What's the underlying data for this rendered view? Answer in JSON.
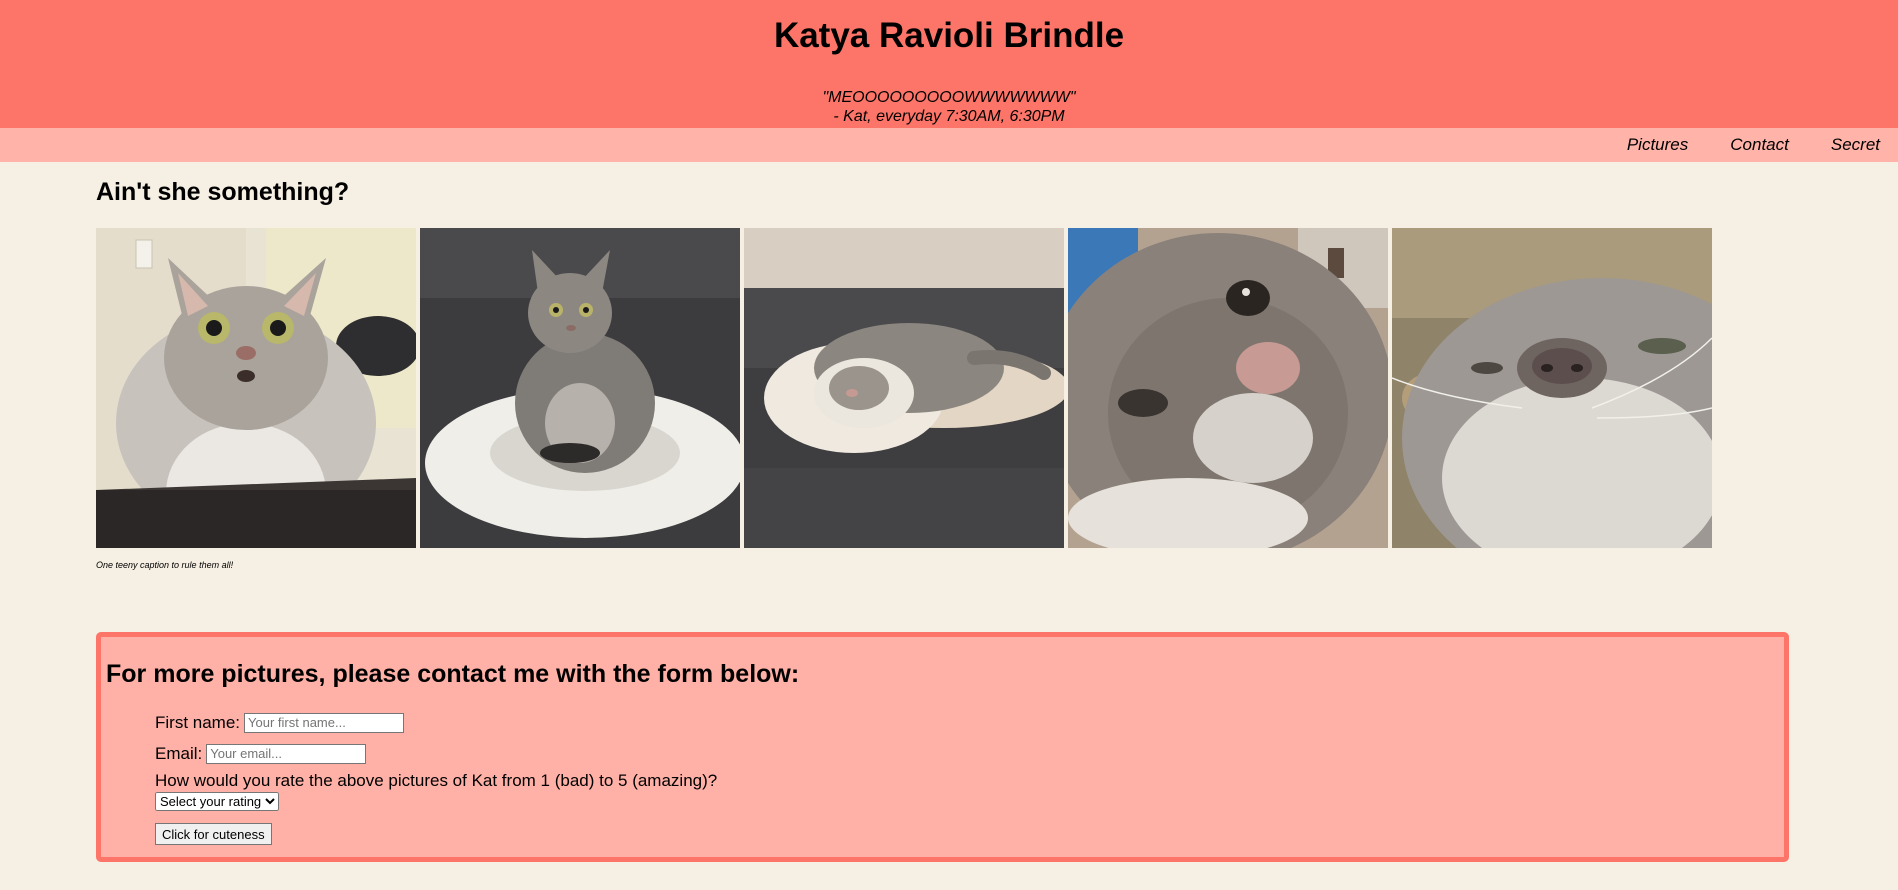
{
  "header": {
    "title": "Katya Ravioli Brindle",
    "quote_line1": "\"MEOOOOOOOOOWWWWWWW\"",
    "quote_line2": "- Kat, everyday 7:30AM, 6:30PM"
  },
  "nav": {
    "items": [
      "Pictures",
      "Contact",
      "Secret"
    ]
  },
  "gallery": {
    "heading": "Ain't she something?",
    "caption": "One teeny caption to rule them all!",
    "photos": [
      {
        "label": "cat-startled-photo"
      },
      {
        "label": "cat-on-cushion-photo"
      },
      {
        "label": "cat-curled-sleeping-photo"
      },
      {
        "label": "cat-closeup-photo"
      },
      {
        "label": "cat-nose-closeup-photo"
      }
    ]
  },
  "form": {
    "heading": "For more pictures, please contact me with the form below:",
    "first_name_label": "First name:",
    "first_name_placeholder": "Your first name...",
    "email_label": "Email:",
    "email_placeholder": "Your email...",
    "rating_question": "How would you rate the above pictures of Kat from 1 (bad) to 5 (amazing)?",
    "rating_selected": "Select your rating",
    "submit_label": "Click for cuteness"
  },
  "colors": {
    "header_bg": "#fd7468",
    "nav_bg": "#ffb3a9",
    "page_bg": "#f6efe3",
    "form_border": "#fd7468",
    "form_bg": "#ffb1a7"
  }
}
